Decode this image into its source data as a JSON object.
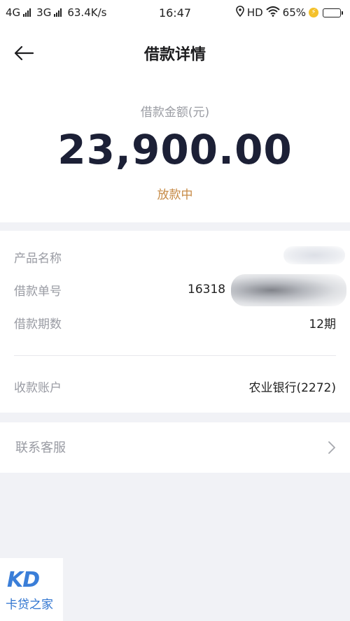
{
  "status_bar": {
    "network1": "4G",
    "network2": "3G",
    "speed": "63.4K/s",
    "time": "16:47",
    "hd": "HD",
    "battery": "65%",
    "battery_level": 0.65
  },
  "header": {
    "title": "借款详情"
  },
  "amount": {
    "label": "借款金额(元)",
    "value": "23,900.00",
    "status": "放款中"
  },
  "details": {
    "product_name_label": "产品名称",
    "loan_no_label": "借款单号",
    "loan_no_value": "16318",
    "periods_label": "借款期数",
    "periods_value": "12期",
    "account_label": "收款账户",
    "account_value": "农业银行(2272)"
  },
  "contact": {
    "label": "联系客服"
  },
  "watermark": {
    "logo": "KD",
    "text": "卡贷之家"
  }
}
